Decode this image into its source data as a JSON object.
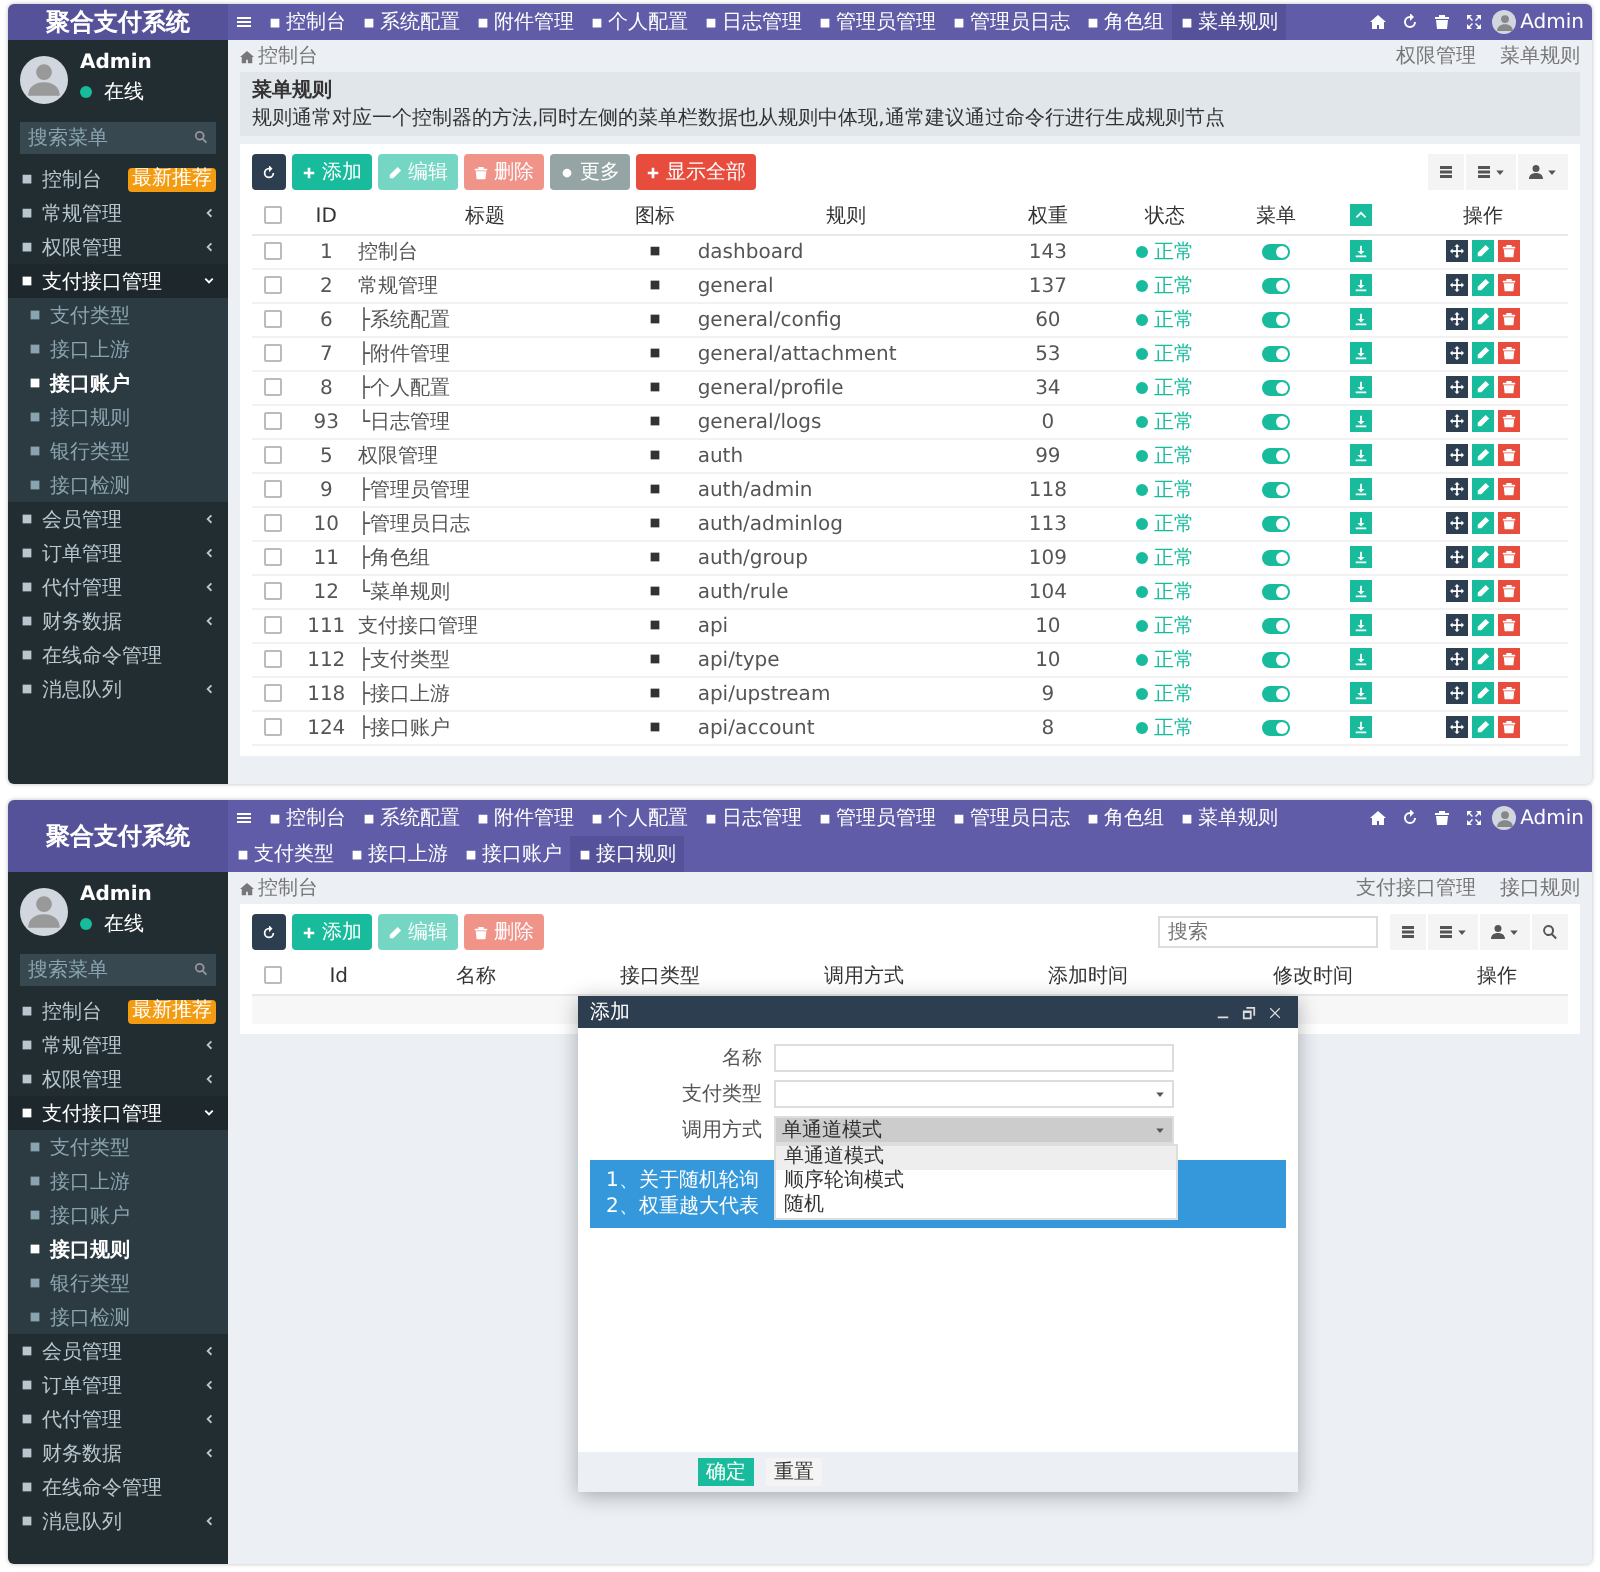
{
  "screens": [
    {
      "app_title": "聚合支付系统",
      "user": {
        "name": "Admin",
        "status": "在线"
      },
      "sidebar_search": {
        "placeholder": "搜索菜单"
      },
      "sidebar": [
        {
          "label": "控制台",
          "badge": "最新推荐",
          "selected": false
        },
        {
          "label": "常规管理",
          "expanded": false,
          "selected": false
        },
        {
          "label": "权限管理",
          "expanded": false,
          "selected": false
        },
        {
          "label": "支付接口管理",
          "expanded": true,
          "selected": false,
          "children": [
            {
              "label": "支付类型",
              "selected": false
            },
            {
              "label": "接口上游",
              "selected": false
            },
            {
              "label": "接口账户",
              "selected": true
            },
            {
              "label": "接口规则",
              "selected": false
            },
            {
              "label": "银行类型",
              "selected": false
            },
            {
              "label": "接口检测",
              "selected": false
            }
          ]
        },
        {
          "label": "会员管理",
          "expanded": false,
          "selected": false
        },
        {
          "label": "订单管理",
          "expanded": false,
          "selected": false
        },
        {
          "label": "代付管理",
          "expanded": false,
          "selected": false
        },
        {
          "label": "财务数据",
          "expanded": false,
          "selected": false
        },
        {
          "label": "在线命令管理",
          "selected": false
        },
        {
          "label": "消息队列",
          "expanded": false,
          "selected": false
        }
      ],
      "nav": [
        {
          "label": "控制台",
          "selected": false
        },
        {
          "label": "系统配置",
          "selected": false
        },
        {
          "label": "附件管理",
          "selected": false
        },
        {
          "label": "个人配置",
          "selected": false
        },
        {
          "label": "日志管理",
          "selected": false
        },
        {
          "label": "管理员管理",
          "selected": false
        },
        {
          "label": "管理员日志",
          "selected": false
        },
        {
          "label": "角色组",
          "selected": false
        },
        {
          "label": "菜单规则",
          "selected": true
        }
      ],
      "nav_user": "Admin",
      "breadcrumb_home": "控制台",
      "breadcrumb": [
        "权限管理",
        "菜单规则"
      ],
      "notice": {
        "title": "菜单规则",
        "text": "规则通常对应一个控制器的方法,同时左侧的菜单栏数据也从规则中体现,通常建议通过命令行进行生成规则节点"
      },
      "toolbar": [
        {
          "kind": "refresh",
          "disabled": false
        },
        {
          "kind": "add",
          "label": "添加",
          "disabled": false
        },
        {
          "kind": "edit",
          "label": "编辑",
          "disabled": true
        },
        {
          "kind": "delete",
          "label": "删除",
          "disabled": true
        },
        {
          "kind": "more",
          "label": "更多",
          "disabled": false
        },
        {
          "kind": "show_all",
          "label": "显示全部",
          "disabled": false
        }
      ],
      "table": {
        "columns": [
          {
            "kind": "checkbox",
            "checked": false
          },
          {
            "kind": "text",
            "label": "ID"
          },
          {
            "kind": "text",
            "label": "标题"
          },
          {
            "kind": "text",
            "label": "图标"
          },
          {
            "kind": "text",
            "label": "规则"
          },
          {
            "kind": "text",
            "label": "权重"
          },
          {
            "kind": "text",
            "label": "状态"
          },
          {
            "kind": "text",
            "label": "菜单"
          },
          {
            "kind": "icon"
          },
          {
            "kind": "text",
            "label": "操作"
          }
        ],
        "rows": [
          {
            "checked": false,
            "id": "1",
            "title": "控制台",
            "rule": "dashboard",
            "weight": "143",
            "status": "正常",
            "menu": true
          },
          {
            "checked": false,
            "id": "2",
            "title": "常规管理",
            "rule": "general",
            "weight": "137",
            "status": "正常",
            "menu": true
          },
          {
            "checked": false,
            "id": "6",
            "title": "├系统配置",
            "rule": "general/config",
            "weight": "60",
            "status": "正常",
            "menu": true
          },
          {
            "checked": false,
            "id": "7",
            "title": "├附件管理",
            "rule": "general/attachment",
            "weight": "53",
            "status": "正常",
            "menu": true
          },
          {
            "checked": false,
            "id": "8",
            "title": "├个人配置",
            "rule": "general/profile",
            "weight": "34",
            "status": "正常",
            "menu": true
          },
          {
            "checked": false,
            "id": "93",
            "title": "└日志管理",
            "rule": "general/logs",
            "weight": "0",
            "status": "正常",
            "menu": true
          },
          {
            "checked": false,
            "id": "5",
            "title": "权限管理",
            "rule": "auth",
            "weight": "99",
            "status": "正常",
            "menu": true
          },
          {
            "checked": false,
            "id": "9",
            "title": "├管理员管理",
            "rule": "auth/admin",
            "weight": "118",
            "status": "正常",
            "menu": true
          },
          {
            "checked": false,
            "id": "10",
            "title": "├管理员日志",
            "rule": "auth/adminlog",
            "weight": "113",
            "status": "正常",
            "menu": true
          },
          {
            "checked": false,
            "id": "11",
            "title": "├角色组",
            "rule": "auth/group",
            "weight": "109",
            "status": "正常",
            "menu": true
          },
          {
            "checked": false,
            "id": "12",
            "title": "└菜单规则",
            "rule": "auth/rule",
            "weight": "104",
            "status": "正常",
            "menu": true
          },
          {
            "checked": false,
            "id": "111",
            "title": "支付接口管理",
            "rule": "api",
            "weight": "10",
            "status": "正常",
            "menu": true
          },
          {
            "checked": false,
            "id": "112",
            "title": "├支付类型",
            "rule": "api/type",
            "weight": "10",
            "status": "正常",
            "menu": true
          },
          {
            "checked": false,
            "id": "118",
            "title": "├接口上游",
            "rule": "api/upstream",
            "weight": "9",
            "status": "正常",
            "menu": true
          },
          {
            "checked": false,
            "id": "124",
            "title": "├接口账户",
            "rule": "api/account",
            "weight": "8",
            "status": "正常",
            "menu": true
          }
        ]
      }
    },
    {
      "app_title": "聚合支付系统",
      "user": {
        "name": "Admin",
        "status": "在线"
      },
      "sidebar_search": {
        "placeholder": "搜索菜单"
      },
      "sidebar": [
        {
          "label": "控制台",
          "badge": "最新推荐",
          "selected": false
        },
        {
          "label": "常规管理",
          "expanded": false,
          "selected": false
        },
        {
          "label": "权限管理",
          "expanded": false,
          "selected": false
        },
        {
          "label": "支付接口管理",
          "expanded": true,
          "selected": false,
          "children": [
            {
              "label": "支付类型",
              "selected": false
            },
            {
              "label": "接口上游",
              "selected": false
            },
            {
              "label": "接口账户",
              "selected": false
            },
            {
              "label": "接口规则",
              "selected": true
            },
            {
              "label": "银行类型",
              "selected": false
            },
            {
              "label": "接口检测",
              "selected": false
            }
          ]
        },
        {
          "label": "会员管理",
          "expanded": false,
          "selected": false
        },
        {
          "label": "订单管理",
          "expanded": false,
          "selected": false
        },
        {
          "label": "代付管理",
          "expanded": false,
          "selected": false
        },
        {
          "label": "财务数据",
          "expanded": false,
          "selected": false
        },
        {
          "label": "在线命令管理",
          "selected": false
        },
        {
          "label": "消息队列",
          "expanded": false,
          "selected": false
        }
      ],
      "nav": [
        {
          "label": "控制台",
          "selected": false
        },
        {
          "label": "系统配置",
          "selected": false
        },
        {
          "label": "附件管理",
          "selected": false
        },
        {
          "label": "个人配置",
          "selected": false
        },
        {
          "label": "日志管理",
          "selected": false
        },
        {
          "label": "管理员管理",
          "selected": false
        },
        {
          "label": "管理员日志",
          "selected": false
        },
        {
          "label": "角色组",
          "selected": false
        },
        {
          "label": "菜单规则",
          "selected": false
        },
        {
          "label": "支付类型",
          "selected": false
        },
        {
          "label": "接口上游",
          "selected": false
        },
        {
          "label": "接口账户",
          "selected": false
        },
        {
          "label": "接口规则",
          "selected": true
        }
      ],
      "nav_user": "Admin",
      "breadcrumb_home": "控制台",
      "breadcrumb": [
        "支付接口管理",
        "接口规则"
      ],
      "toolbar": [
        {
          "kind": "refresh",
          "disabled": false
        },
        {
          "kind": "add",
          "label": "添加",
          "disabled": false
        },
        {
          "kind": "edit",
          "label": "编辑",
          "disabled": true
        },
        {
          "kind": "delete",
          "label": "删除",
          "disabled": true
        }
      ],
      "search": {
        "placeholder": "搜索"
      },
      "table": {
        "columns": [
          {
            "kind": "checkbox",
            "checked": false
          },
          {
            "kind": "text",
            "label": "Id"
          },
          {
            "kind": "text",
            "label": "名称"
          },
          {
            "kind": "text",
            "label": "接口类型"
          },
          {
            "kind": "text",
            "label": "调用方式"
          },
          {
            "kind": "text",
            "label": "添加时间"
          },
          {
            "kind": "text",
            "label": "修改时间"
          },
          {
            "kind": "text",
            "label": "操作"
          }
        ]
      },
      "dialog": {
        "title": "添加",
        "fields": [
          {
            "label": "名称",
            "kind": "text"
          },
          {
            "label": "支付类型",
            "kind": "select"
          },
          {
            "label": "调用方式",
            "kind": "select",
            "value": "单通道模式",
            "open": true
          }
        ],
        "options": [
          {
            "label": "单通道模式",
            "selected": true
          },
          {
            "label": "顺序轮询模式",
            "selected": false
          },
          {
            "label": "随机",
            "selected": false
          }
        ],
        "notice_lines": [
          "1、关于随机轮询",
          "2、权重越大代表"
        ],
        "buttons": [
          {
            "label": "确定",
            "kind": "primary"
          },
          {
            "label": "重置",
            "kind": "plain"
          }
        ]
      }
    }
  ]
}
